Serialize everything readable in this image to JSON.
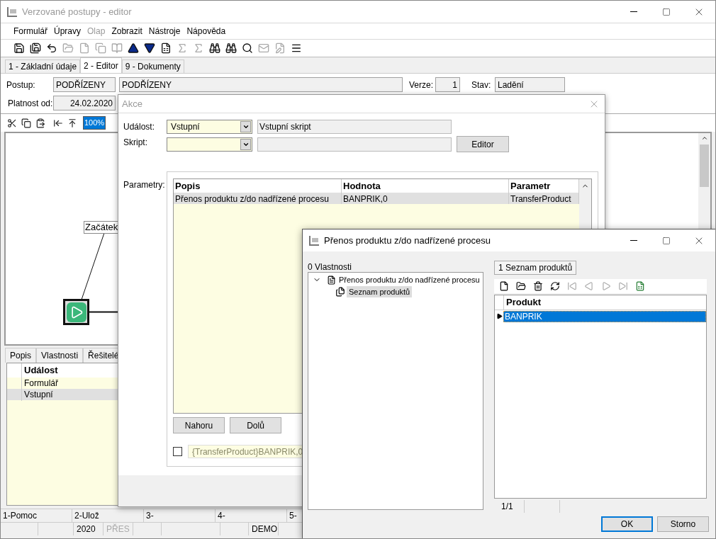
{
  "main_window": {
    "title": "Verzované postupy - editor",
    "active": false
  },
  "menu": [
    {
      "label": "Formulář",
      "disabled": false
    },
    {
      "label": "Úpravy",
      "disabled": false
    },
    {
      "label": "Olap",
      "disabled": true
    },
    {
      "label": "Zobrazit",
      "disabled": false
    },
    {
      "label": "Nástroje",
      "disabled": false
    },
    {
      "label": "Nápověda",
      "disabled": false
    }
  ],
  "toolbar": [
    {
      "disabled": false
    },
    {
      "disabled": false
    },
    {
      "disabled": false
    },
    {
      "disabled": true
    },
    {
      "disabled": true
    },
    {
      "disabled": true
    },
    {
      "disabled": true
    },
    {
      "disabled": false
    },
    {
      "disabled": false
    },
    {
      "disabled": false
    },
    {
      "disabled": true
    },
    {
      "disabled": true
    },
    {
      "disabled": false
    },
    {
      "disabled": false
    },
    {
      "disabled": false
    },
    {
      "disabled": true
    },
    {
      "disabled": true
    },
    {
      "disabled": false
    }
  ],
  "tabs": [
    {
      "label": "1 - Základní údaje",
      "selected": false
    },
    {
      "label": "2 - Editor",
      "selected": true
    },
    {
      "label": "9 - Dokumenty",
      "selected": false
    }
  ],
  "form": {
    "postup_label": "Postup:",
    "postup_code": "PODŘÍZENY",
    "postup_name": "PODŘÍZENY",
    "verze_label": "Verze:",
    "verze": "1",
    "stav_label": "Stav:",
    "stav": "Ladění",
    "platnost_label": "Platnost od:",
    "platnost": "24.02.2020"
  },
  "editor_toolbar": {
    "zoom": "100%"
  },
  "canvas": {
    "start_label": "Začátek"
  },
  "bottom_tabs": [
    "Popis",
    "Vlastnosti",
    "Řešitelé"
  ],
  "events_table": {
    "column": "Událost",
    "rows": [
      {
        "text": "Formulář",
        "selected": false
      },
      {
        "text": "Vstupní",
        "selected": true
      }
    ]
  },
  "status_bar": {
    "row_1": [
      "1-Pomoc",
      "2-Ulož",
      "3-",
      "4-",
      "5-"
    ],
    "row_2": [
      {
        "text": "2020",
        "disabled": false
      },
      {
        "text": "PŘES",
        "disabled": true
      },
      {
        "text": "DEMO",
        "disabled": false
      }
    ]
  },
  "akce_dialog": {
    "title": "Akce",
    "event_label": "Událost:",
    "event_value": "Vstupní",
    "event_description": "Vstupní skript",
    "script_label": "Skript:",
    "editor_button": "Editor",
    "params_label": "Parametry:",
    "params_table": {
      "columns": [
        "Popis",
        "Hodnota",
        "Parametr"
      ],
      "rows": [
        {
          "cells": [
            "Přenos produktu z/do nadřízené procesu",
            "BANPRIK,0",
            "TransferProduct"
          ],
          "selected": true
        }
      ]
    },
    "buttons": [
      "Nahoru",
      "Dolů"
    ],
    "checkbox": {
      "checked": false
    },
    "expression": "{TransferProduct}BANPRIK,0"
  },
  "transfer_dialog": {
    "title": "Přenos produktu z/do nadřízené procesu",
    "left_tab": "0 Vlastnosti",
    "tree": [
      {
        "label": "Přenos produktu z/do nadřízené procesu",
        "expanded": true,
        "selected": false,
        "children": [
          {
            "label": "Seznam produktů",
            "selected": true
          }
        ]
      }
    ],
    "right_tab": "1 Seznam produktů",
    "grid_toolbar": [
      {
        "disabled": false
      },
      {
        "disabled": false
      },
      {
        "disabled": false
      },
      {
        "disabled": false
      },
      {
        "disabled": true
      },
      {
        "disabled": true
      },
      {
        "disabled": true
      },
      {
        "disabled": true
      },
      {
        "disabled": false
      }
    ],
    "grid": {
      "column": "Produkt",
      "rows": [
        {
          "text": "BANPRIK",
          "selected": true
        }
      ]
    },
    "record_count": "1/1",
    "buttons": [
      {
        "label": "OK",
        "default": true
      },
      {
        "label": "Storno",
        "default": false
      }
    ]
  }
}
